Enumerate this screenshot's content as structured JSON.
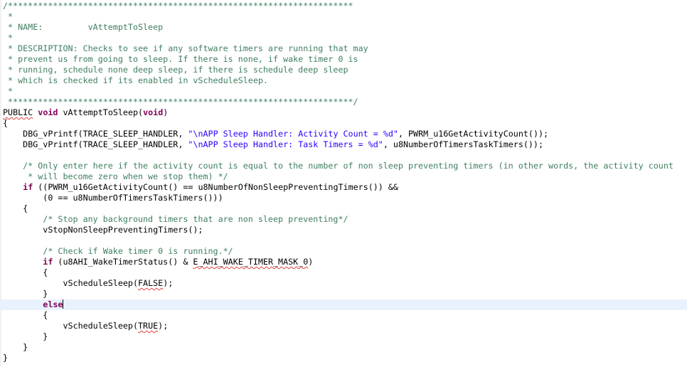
{
  "editor": {
    "lines": [
      "/*********************************************************************",
      " *",
      " * NAME:         vAttemptToSleep",
      " *",
      " * DESCRIPTION: Checks to see if any software timers are running that may",
      " * prevent us from going to sleep. If there is none, if wake timer 0 is",
      " * running, schedule none deep sleep, if there is schedule deep sleep",
      " * which is checked if its enabled in vScheduleSleep.",
      " *",
      " *********************************************************************/",
      "PUBLIC void vAttemptToSleep(void)",
      "{",
      "    DBG_vPrintf(TRACE_SLEEP_HANDLER, \"\\nAPP Sleep Handler: Activity Count = %d\", PWRM_u16GetActivityCount());",
      "    DBG_vPrintf(TRACE_SLEEP_HANDLER, \"\\nAPP Sleep Handler: Task Timers = %d\", u8NumberOfTimersTaskTimers());",
      "",
      "    /* Only enter here if the activity count is equal to the number of non sleep preventing timers (in other words, the activity count",
      "     * will become zero when we stop them) */",
      "    if ((PWRM_u16GetActivityCount() == u8NumberOfNonSleepPreventingTimers()) &&",
      "        (0 == u8NumberOfTimersTaskTimers()))",
      "    {",
      "        /* Stop any background timers that are non sleep preventing*/",
      "        vStopNonSleepPreventingTimers();",
      "",
      "        /* Check if Wake timer 0 is running.*/",
      "        if (u8AHI_WakeTimerStatus() & E_AHI_WAKE_TIMER_MASK_0)",
      "        {",
      "            vScheduleSleep(FALSE);",
      "        }",
      "        else",
      "        {",
      "            vScheduleSleep(TRUE);",
      "        }",
      "    }",
      "}"
    ]
  }
}
